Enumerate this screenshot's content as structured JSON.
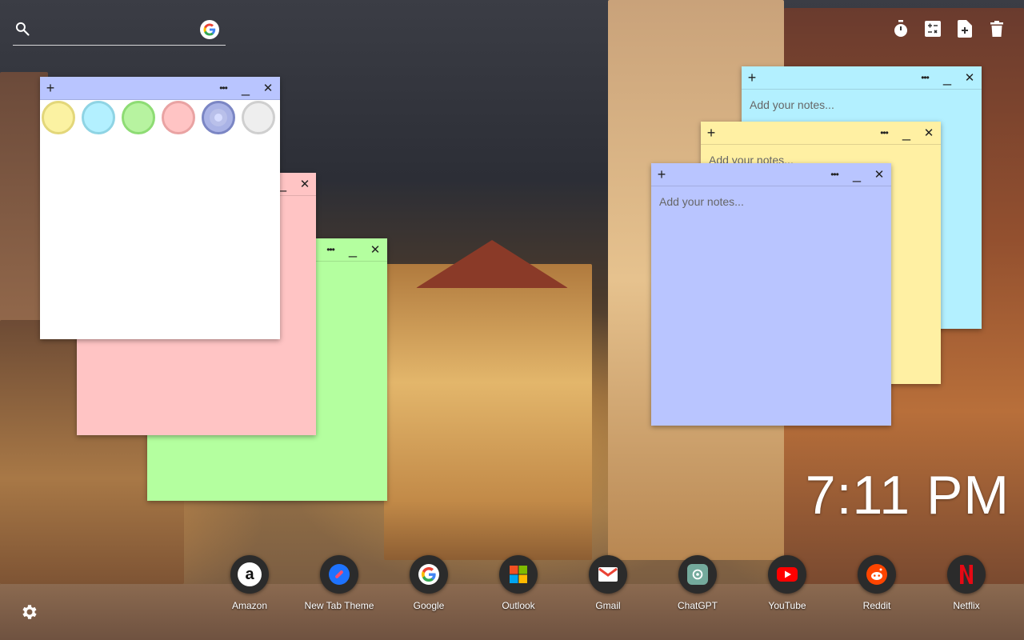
{
  "search": {
    "placeholder": ""
  },
  "toolbar": {
    "timer_icon": "stopwatch-icon",
    "calculator_icon": "calculator-icon",
    "new_note_icon": "add-note-icon",
    "delete_icon": "trash-icon"
  },
  "notes": {
    "placeholder": "Add your notes...",
    "add_symbol": "+",
    "menu_symbol": "•••",
    "minimize_symbol": "_",
    "close_symbol": "✕",
    "colors": {
      "white": "#ffffff",
      "pink": "#ffc4c4",
      "green": "#b4ff9f",
      "cyan": "#b3f0ff",
      "yellow": "#fff0a3",
      "blue": "#b9c5ff",
      "header_blue": "#b9c5ff"
    },
    "swatches": [
      {
        "name": "yellow",
        "fill": "#fbf2a2",
        "ring": "#e3d77a"
      },
      {
        "name": "cyan",
        "fill": "#b3f0ff",
        "ring": "#8fd4e4"
      },
      {
        "name": "green",
        "fill": "#b7f3a0",
        "ring": "#8edc74"
      },
      {
        "name": "pink",
        "fill": "#ffc4c4",
        "ring": "#e9a3a3"
      },
      {
        "name": "blue",
        "fill": "#aab3e6",
        "ring": "#7b86c4"
      },
      {
        "name": "white",
        "fill": "#eeeeee",
        "ring": "#cfcfcf"
      }
    ]
  },
  "clock": {
    "time": "7:11 PM"
  },
  "dock": {
    "items": [
      {
        "label": "Amazon",
        "icon": "amazon-icon"
      },
      {
        "label": "New Tab Theme",
        "icon": "new-tab-theme-icon"
      },
      {
        "label": "Google",
        "icon": "google-icon"
      },
      {
        "label": "Outlook",
        "icon": "outlook-icon"
      },
      {
        "label": "Gmail",
        "icon": "gmail-icon"
      },
      {
        "label": "ChatGPT",
        "icon": "chatgpt-icon"
      },
      {
        "label": "YouTube",
        "icon": "youtube-icon"
      },
      {
        "label": "Reddit",
        "icon": "reddit-icon"
      },
      {
        "label": "Netflix",
        "icon": "netflix-icon"
      }
    ]
  },
  "settings": {
    "icon": "gear-icon"
  }
}
